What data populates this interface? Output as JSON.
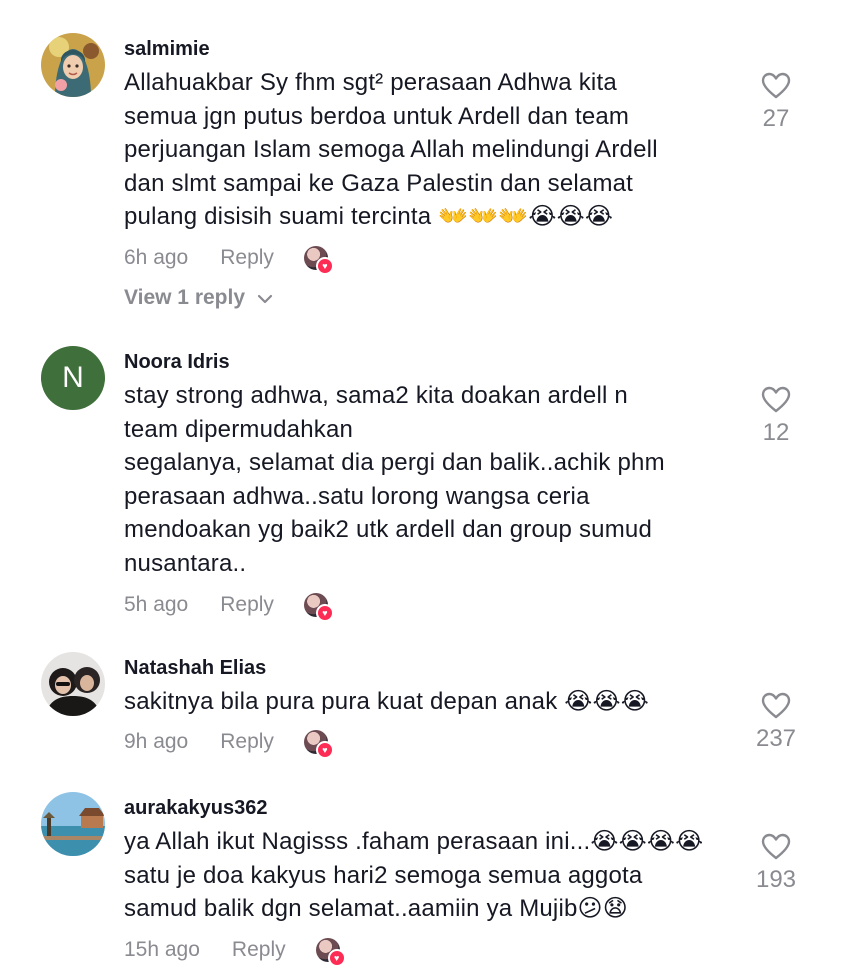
{
  "comments": [
    {
      "username": "salmimie",
      "text": "Allahuakbar Sy fhm sgt² perasaan Adhwa kita\nsemua jgn putus berdoa untuk Ardell dan team\nperjuangan Islam semoga Allah melindungi Ardell\ndan slmt sampai ke Gaza Palestin dan selamat\npulang disisih suami tercinta 👐👐👐😭😭😭",
      "time": "6h ago",
      "reply_label": "Reply",
      "likes": "27",
      "view_replies": "View 1 reply"
    },
    {
      "username": "Noora Idris",
      "avatar_letter": "N",
      "text": "stay strong adhwa, sama2 kita doakan ardell n\nteam dipermudahkan\nsegalanya, selamat dia pergi dan balik..achik phm\nperasaan adhwa..satu lorong wangsa ceria\nmendoakan yg baik2 utk ardell dan group sumud\nnusantara..",
      "time": "5h ago",
      "reply_label": "Reply",
      "likes": "12"
    },
    {
      "username": "Natashah Elias",
      "text": "sakitnya bila pura pura kuat depan anak 😭😭😭",
      "time": "9h ago",
      "reply_label": "Reply",
      "likes": "237"
    },
    {
      "username": "aurakakyus362",
      "text": "ya Allah ikut Nagisss .faham perasaan ini...😭😭😭😭\nsatu je doa kakyus hari2 semoga semua aggota\nsamud balik dgn selamat..aamiin ya Mujib😕😧",
      "time": "15h ago",
      "reply_label": "Reply",
      "likes": "193"
    }
  ],
  "colors": {
    "text": "#161823",
    "muted": "#8a8b91",
    "heart_badge": "#fe2c55",
    "avatar_letter_bg": "#3f6f3a"
  },
  "icons": {
    "like": "heart-outline-icon",
    "expand": "chevron-down-icon",
    "liked_by_creator": "heart-badge-icon"
  }
}
